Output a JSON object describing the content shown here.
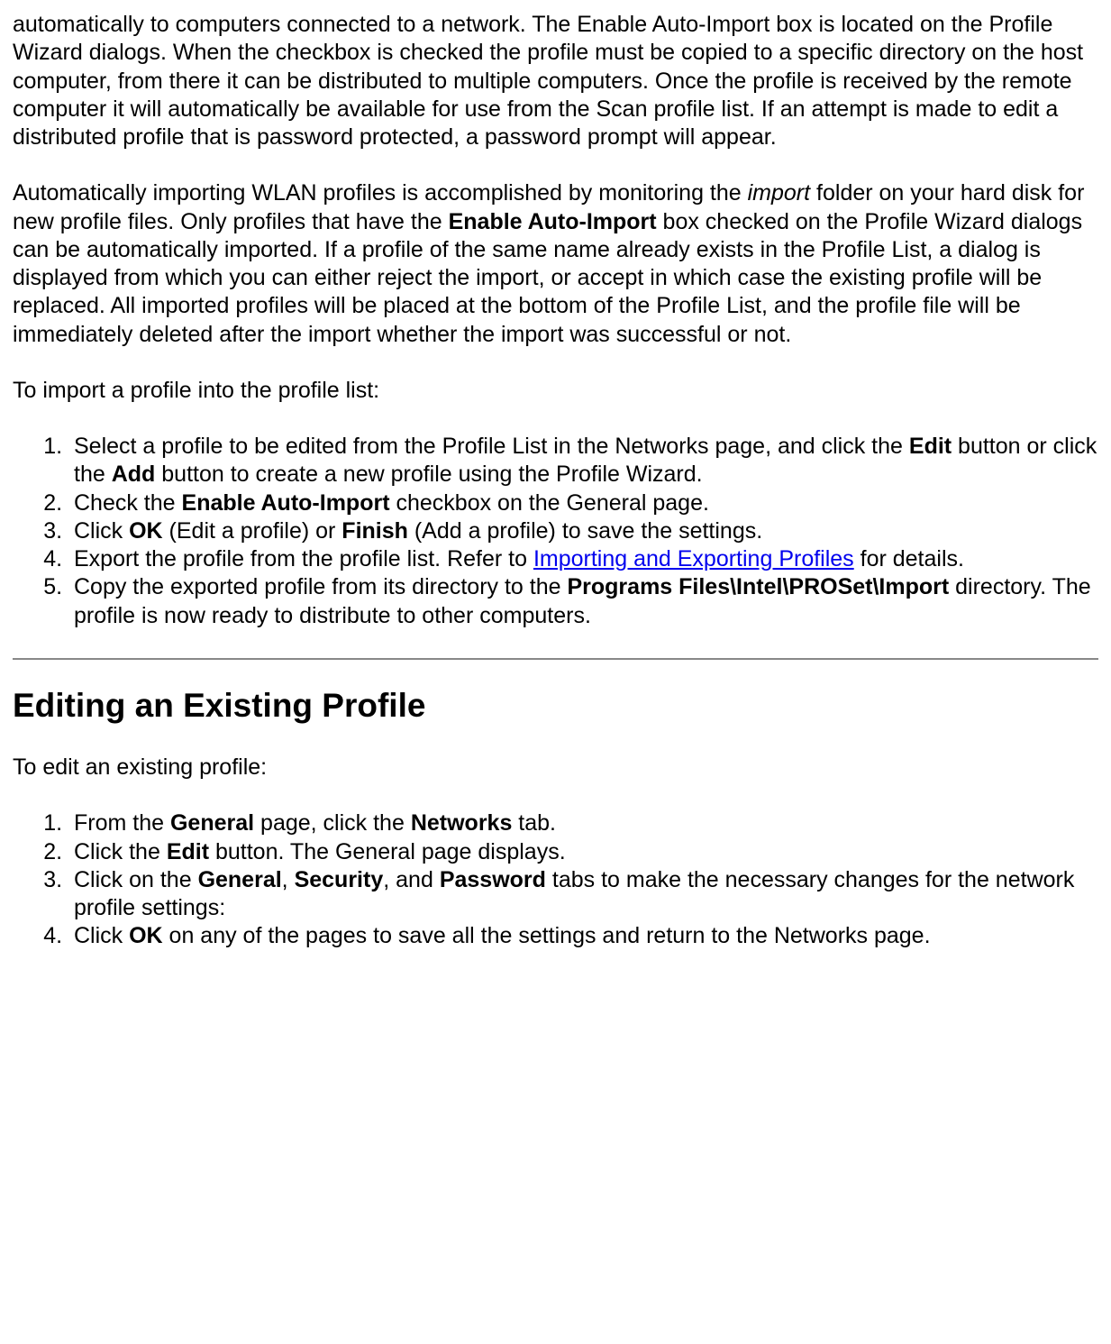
{
  "para1_a": "automatically to computers connected to a network. The Enable Auto-Import box is located on the Profile Wizard dialogs. When the checkbox is checked the profile must be copied to a specific directory on the host computer, from there it can be distributed to multiple computers. Once the profile is received by the remote computer it will automatically be available for use from the Scan profile list. If an attempt is made to edit a distributed profile that is password protected, a password prompt will appear.",
  "para2_a": "Automatically importing WLAN profiles is accomplished by monitoring the ",
  "para2_import": "import",
  "para2_b": " folder on your hard disk for new profile files. Only profiles that have the ",
  "para2_enable": "Enable Auto-Import",
  "para2_c": " box checked on the Profile Wizard dialogs can be automatically imported. If a profile of the same name already exists in the Profile List, a dialog is displayed from which you can either reject the import, or accept in which case the existing profile will be replaced. All imported profiles will be placed at the bottom of the Profile List, and the profile file will be immediately deleted after the import whether the import was successful or not.",
  "para3": "To import a profile into the profile list:",
  "list1": {
    "i1_a": "Select a profile to be edited from the Profile List in the Networks page, and click the ",
    "i1_edit": "Edit",
    "i1_b": " button or click the ",
    "i1_add": "Add",
    "i1_c": " button to create a new profile using the Profile Wizard.",
    "i2_a": "Check the ",
    "i2_enable": "Enable Auto-Import",
    "i2_b": " checkbox on the General page.",
    "i3_a": "Click ",
    "i3_ok": "OK",
    "i3_b": " (Edit a profile) or ",
    "i3_finish": "Finish",
    "i3_c": " (Add a profile) to save the settings.",
    "i4_a": "Export the profile from the profile list. Refer to ",
    "i4_link": "Importing and Exporting Profiles",
    "i4_b": " for details.",
    "i5_a": "Copy the exported profile from its directory to the ",
    "i5_path": "Programs Files\\Intel\\PROSet\\Import",
    "i5_b": " directory. The profile is now ready to distribute to other computers."
  },
  "heading2": "Editing an Existing Profile",
  "para4": "To edit an existing profile:",
  "list2": {
    "i1_a": "From the ",
    "i1_general": "General",
    "i1_b": " page, click the ",
    "i1_networks": "Networks",
    "i1_c": " tab.",
    "i2_a": "Click the ",
    "i2_edit": "Edit",
    "i2_b": " button. The General page displays.",
    "i3_a": "Click on the ",
    "i3_general": "General",
    "i3_b": ", ",
    "i3_security": "Security",
    "i3_c": ", and ",
    "i3_password": "Password",
    "i3_d": " tabs to make the necessary changes for the network profile settings:",
    "i4_a": "Click ",
    "i4_ok": "OK",
    "i4_b": " on any of the pages to save all the settings and return to the Networks page."
  }
}
